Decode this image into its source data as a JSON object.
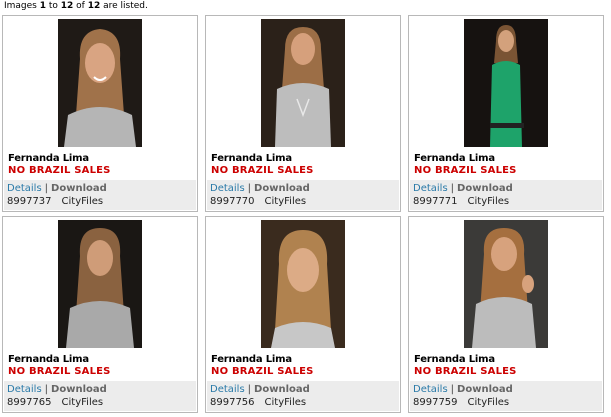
{
  "status": {
    "prefix": "Images ",
    "from": "1",
    "mid": " to ",
    "to": "12",
    "of_label": " of ",
    "total": "12",
    "suffix": " are listed."
  },
  "cards": [
    {
      "name": "Fernanda Lima",
      "restriction": "NO BRAZIL SALES",
      "details": "Details",
      "sep": "|",
      "download": "Download",
      "id": "8997737",
      "source": "CityFiles",
      "bg": "#1f1a16",
      "outfit": "#b5b5b5"
    },
    {
      "name": "Fernanda Lima",
      "restriction": "NO BRAZIL SALES",
      "details": "Details",
      "sep": "|",
      "download": "Download",
      "id": "8997770",
      "source": "CityFiles",
      "bg": "#2b2119",
      "outfit": "#bdbdbd"
    },
    {
      "name": "Fernanda Lima",
      "restriction": "NO BRAZIL SALES",
      "details": "Details",
      "sep": "|",
      "download": "Download",
      "id": "8997771",
      "source": "CityFiles",
      "bg": "#161210",
      "outfit": "#1ea36a"
    },
    {
      "name": "Fernanda Lima",
      "restriction": "NO BRAZIL SALES",
      "details": "Details",
      "sep": "|",
      "download": "Download",
      "id": "8997765",
      "source": "CityFiles",
      "bg": "#1a1714",
      "outfit": "#a9a9a9"
    },
    {
      "name": "Fernanda Lima",
      "restriction": "NO BRAZIL SALES",
      "details": "Details",
      "sep": "|",
      "download": "Download",
      "id": "8997756",
      "source": "CityFiles",
      "bg": "#3a2b1e",
      "outfit": "#c7c7c7"
    },
    {
      "name": "Fernanda Lima",
      "restriction": "NO BRAZIL SALES",
      "details": "Details",
      "sep": "|",
      "download": "Download",
      "id": "8997759",
      "source": "CityFiles",
      "bg": "#3b3a38",
      "outfit": "#bcbcbc"
    }
  ],
  "colors": {
    "restriction": "#cc0000",
    "details_link": "#2a7aa8",
    "footer_bg": "#ececec",
    "card_border": "#b8b8b8"
  }
}
